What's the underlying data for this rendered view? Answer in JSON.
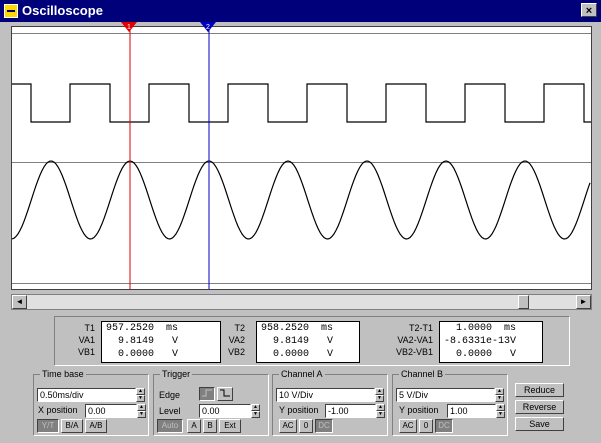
{
  "window": {
    "title": "Oscilloscope",
    "close": "×"
  },
  "cursor": {
    "t1": "1",
    "t2": "2"
  },
  "scroll": {
    "left": "◄",
    "right": "►"
  },
  "readouts": {
    "c1": {
      "labels": [
        "T1",
        "VA1",
        "VB1"
      ],
      "values": [
        "957.2520  ms",
        "  9.8149   V",
        "  0.0000   V"
      ]
    },
    "c2": {
      "labels": [
        "T2",
        "VA2",
        "VB2"
      ],
      "values": [
        "958.2520  ms",
        "  9.8149   V",
        "  0.0000   V"
      ]
    },
    "c3": {
      "labels": [
        "T2-T1",
        "VA2-VA1",
        "VB2-VB1"
      ],
      "values": [
        "  1.0000  ms",
        "-8.6331e-13V",
        "  0.0000   V"
      ]
    }
  },
  "timebase": {
    "title": "Time base",
    "value": "0.50ms/div",
    "xpos_label": "X position",
    "xpos": "0.00",
    "modes": [
      "Y/T",
      "B/A",
      "A/B"
    ]
  },
  "trigger": {
    "title": "Trigger",
    "edge_label": "Edge",
    "level_label": "Level",
    "level": "0.00",
    "buttons": [
      "Auto",
      "A",
      "B",
      "Ext"
    ]
  },
  "channel_a": {
    "title": "Channel A",
    "scale": "10 V/Div",
    "ypos_label": "Y position",
    "ypos": "-1.00",
    "coupling": [
      "AC",
      "0",
      "DC"
    ]
  },
  "channel_b": {
    "title": "Channel B",
    "scale": "5 V/Div",
    "ypos_label": "Y position",
    "ypos": "1.00",
    "coupling": [
      "AC",
      "0",
      "DC"
    ]
  },
  "actions": {
    "reduce": "Reduce",
    "reverse": "Reverse",
    "save": "Save"
  },
  "colors": {
    "titlebar": "#00007b",
    "cursor1": "#e00000",
    "cursor2": "#0000c0",
    "grid": "#808080"
  }
}
